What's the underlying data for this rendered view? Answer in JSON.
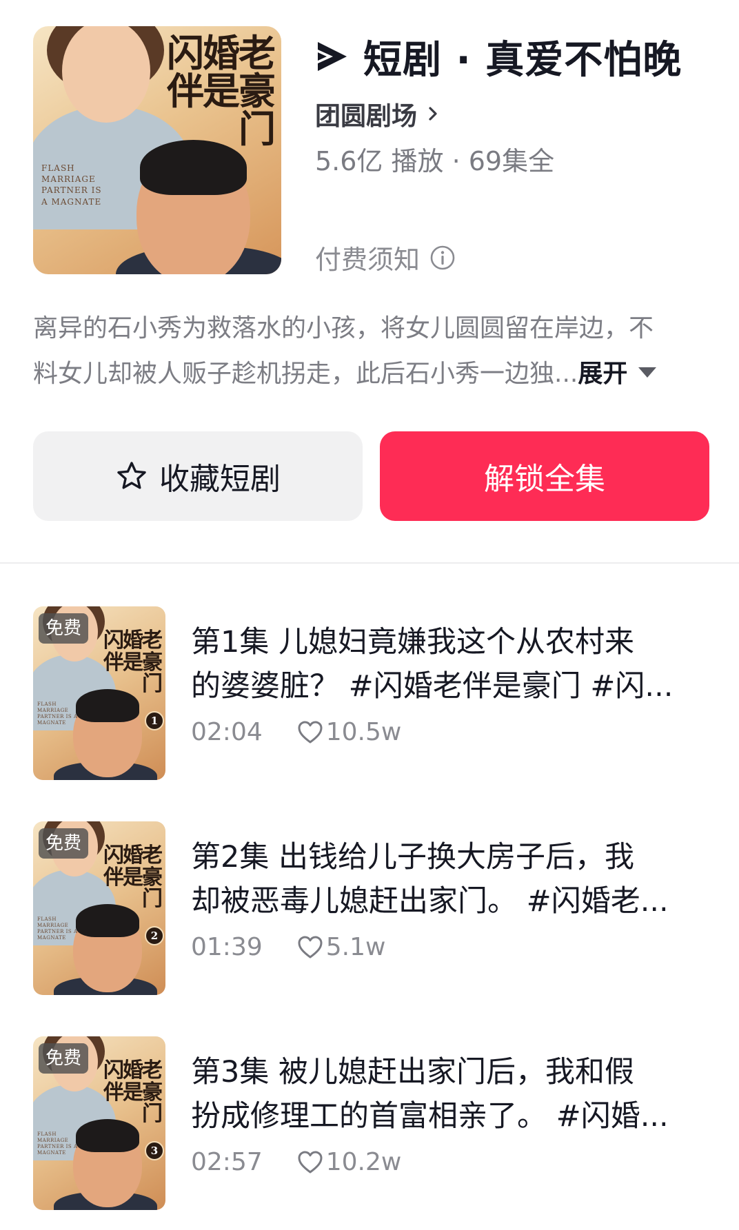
{
  "drama": {
    "cover_title": "闪婚老伴是豪门",
    "cover_en": "FLASH MARRIAGE PARTNER IS A MAGNATE",
    "title": "短剧 · 真爱不怕晚",
    "channel": "团圆剧场",
    "stats": "5.6亿 播放 · 69集全",
    "fee_notice": "付费须知",
    "description_line1": "离异的石小秀为救落水的小孩，将女儿圆圆留在岸边，不",
    "description_line2": "料女儿却被人贩子趁机拐走，此后石小秀一边独...",
    "expand_label": "展开"
  },
  "actions": {
    "favorite_label": "收藏短剧",
    "unlock_label": "解锁全集"
  },
  "colors": {
    "accent": "#fe2c55",
    "text_primary": "#161823",
    "text_secondary": "#7c7d84"
  },
  "episodes": [
    {
      "badge": "免费",
      "num": "1",
      "line1": "第1集  儿媳妇竟嫌我这个从农村来",
      "line2": "的婆婆脏？ #闪婚老伴是豪门 #闪...",
      "duration": "02:04",
      "likes": "10.5w"
    },
    {
      "badge": "免费",
      "num": "2",
      "line1": "第2集  出钱给儿子换大房子后，我",
      "line2": "却被恶毒儿媳赶出家门。 #闪婚老...",
      "duration": "01:39",
      "likes": "5.1w"
    },
    {
      "badge": "免费",
      "num": "3",
      "line1": "第3集  被儿媳赶出家门后，我和假",
      "line2": "扮成修理工的首富相亲了。 #闪婚...",
      "duration": "02:57",
      "likes": "10.2w"
    }
  ]
}
